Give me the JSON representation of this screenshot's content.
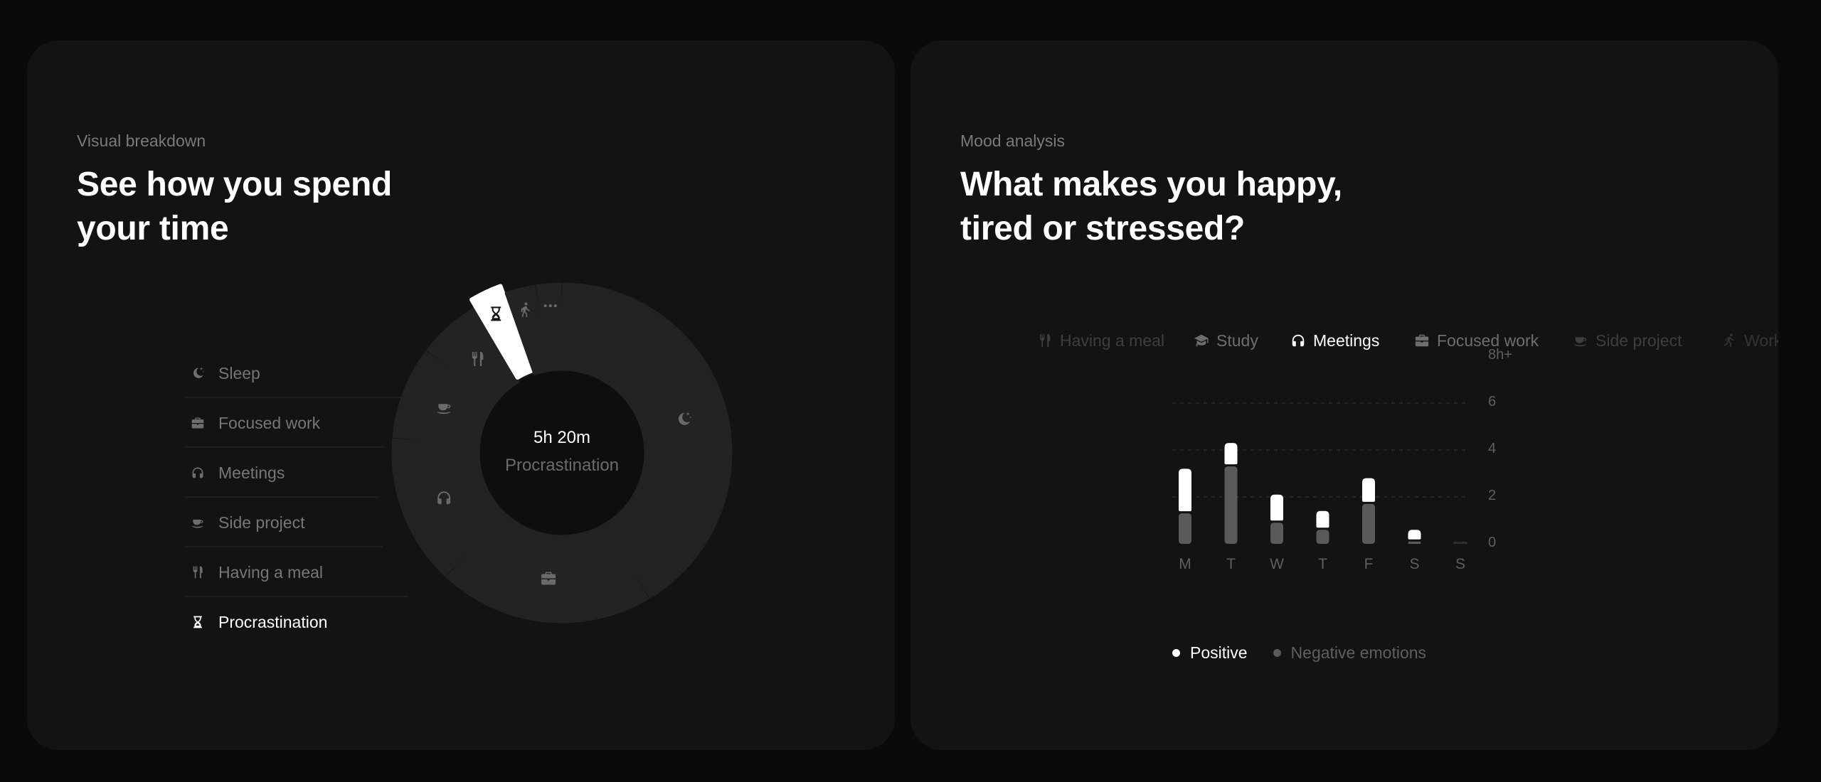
{
  "colors": {
    "page_bg": "#0a0a0a",
    "card_bg": "#131313",
    "segment": "#232323",
    "segment_active": "#ffffff",
    "donut_hole": "#0e0e0e",
    "text_primary": "#ffffff",
    "text_muted": "#767676",
    "positive": "#ffffff",
    "negative": "#5a5a5a",
    "zero_stub": "#2e2e2e"
  },
  "left_card": {
    "eyebrow": "Visual breakdown",
    "title_lines": [
      "See how you spend",
      "your time"
    ],
    "legend": [
      {
        "label": "Sleep",
        "icon": "moon-stars-icon",
        "active": false
      },
      {
        "label": "Focused work",
        "icon": "briefcase-icon",
        "active": false
      },
      {
        "label": "Meetings",
        "icon": "headphones-icon",
        "active": false
      },
      {
        "label": "Side project",
        "icon": "coffee-cup-icon",
        "active": false
      },
      {
        "label": "Having a meal",
        "icon": "fork-knife-icon",
        "active": false
      },
      {
        "label": "Procrastination",
        "icon": "hourglass-icon",
        "active": true
      }
    ],
    "donut_center": {
      "value": "5h 20m",
      "label": "Procrastination"
    }
  },
  "right_card": {
    "eyebrow": "Mood analysis",
    "title_lines": [
      "What makes you happy,",
      "tired or stressed?"
    ],
    "tabs": [
      {
        "label": "Having a meal",
        "icon": "fork-knife-icon",
        "state": "faded"
      },
      {
        "label": "Study",
        "icon": "graduation-cap-icon",
        "state": "inactive"
      },
      {
        "label": "Meetings",
        "icon": "headphones-icon",
        "state": "active"
      },
      {
        "label": "Focused work",
        "icon": "briefcase-icon",
        "state": "inactive"
      },
      {
        "label": "Side project",
        "icon": "coffee-cup-icon",
        "state": "faded"
      },
      {
        "label": "Workout",
        "icon": "running-icon",
        "state": "faded"
      }
    ],
    "legend": [
      {
        "label": "Positive",
        "key": "positive"
      },
      {
        "label": "Negative emotions",
        "key": "negative"
      }
    ]
  },
  "chart_data": [
    {
      "type": "pie",
      "title": "See how you spend your time",
      "variant": "donut",
      "unit": "share of ring (%)",
      "slices": [
        {
          "name": "Sleep",
          "icon": "moon-stars-icon",
          "value": 41.4
        },
        {
          "name": "Focused work",
          "icon": "briefcase-icon",
          "value": 20.6
        },
        {
          "name": "Meetings",
          "icon": "headphones-icon",
          "value": 14.4
        },
        {
          "name": "Side project",
          "icon": "coffee-cup-icon",
          "value": 8.9
        },
        {
          "name": "Having a meal",
          "icon": "fork-knife-icon",
          "value": 6.1
        },
        {
          "name": "Procrastination",
          "icon": "hourglass-icon",
          "value": 3.1,
          "highlighted": true
        },
        {
          "name": "Walking",
          "icon": "walking-icon",
          "value": 3.0
        },
        {
          "name": "Other",
          "icon": "more-dots-icon",
          "value": 2.5
        }
      ],
      "center_text": [
        "5h 20m",
        "Procrastination"
      ]
    },
    {
      "type": "bar",
      "stacked": true,
      "title": "What makes you happy, tired or stressed?",
      "selected_category": "Meetings",
      "categories": [
        "M",
        "T",
        "W",
        "T",
        "F",
        "S",
        "S"
      ],
      "series": [
        {
          "name": "Negative emotions",
          "values": [
            1.3,
            3.3,
            0.9,
            0.6,
            1.7,
            0.1,
            0
          ]
        },
        {
          "name": "Positive",
          "values": [
            1.9,
            1.0,
            1.2,
            0.8,
            1.1,
            0.5,
            0
          ]
        }
      ],
      "yticks": [
        0,
        2,
        4,
        6
      ],
      "ytick_labels": [
        "0",
        "2",
        "4",
        "6",
        "8h+"
      ],
      "ylim": [
        0,
        8
      ],
      "ylabel": "",
      "xlabel": "",
      "grid": "dashed horizontal at 2, 4, 6",
      "legend_position": "bottom-left"
    }
  ]
}
